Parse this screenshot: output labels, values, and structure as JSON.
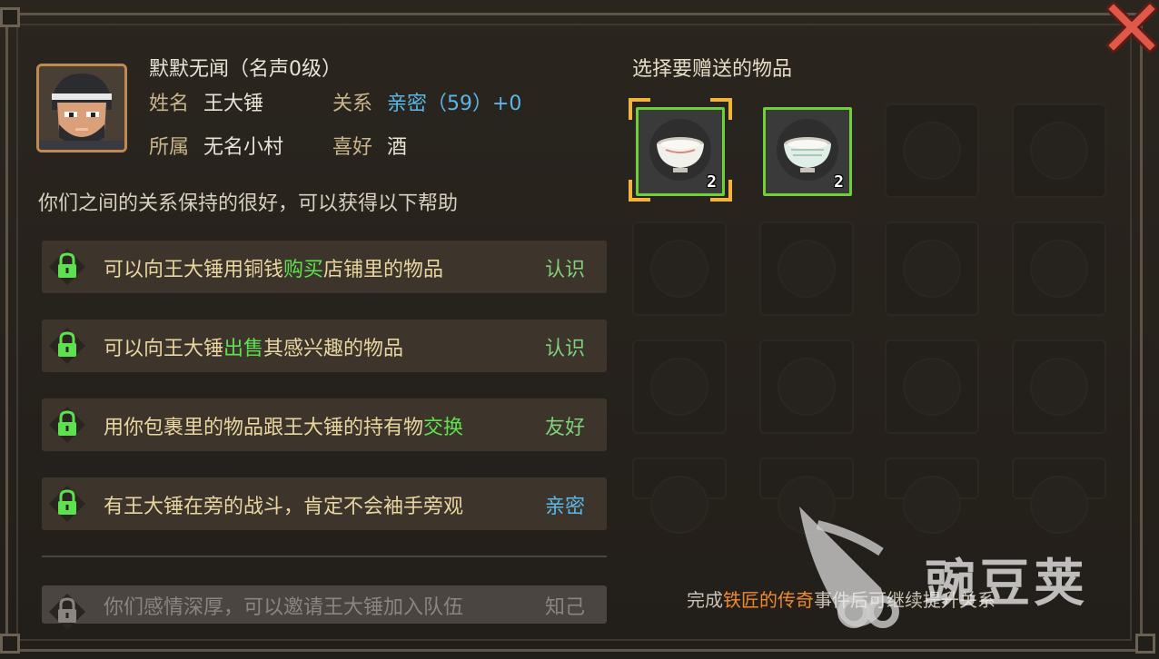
{
  "npc": {
    "title": "默默无闻（名声0级）",
    "name_label": "姓名",
    "name": "王大锤",
    "relation_label": "关系",
    "relation": "亲密（59）+0",
    "faction_label": "所属",
    "faction": "无名小村",
    "hobby_label": "喜好",
    "hobby": "酒"
  },
  "intro": "你们之间的关系保持的很好，可以获得以下帮助",
  "help_rows": [
    {
      "pre": "可以向王大锤用铜钱",
      "hl": "购买",
      "post": "店铺里的物品",
      "level": "认识",
      "level_color": "#7fd07a",
      "locked": false
    },
    {
      "pre": "可以向王大锤",
      "hl": "出售",
      "post": "其感兴趣的物品",
      "level": "认识",
      "level_color": "#7fd07a",
      "locked": false
    },
    {
      "pre": "用你包裹里的物品跟王大锤的持有物",
      "hl": "交换",
      "post": "",
      "level": "友好",
      "level_color": "#7fd07a",
      "locked": false
    },
    {
      "pre": "有王大锤在旁的战斗，肯定不会袖手旁观",
      "hl": "",
      "post": "",
      "level": "亲密",
      "level_color": "#5ab7e6",
      "locked": false
    },
    {
      "pre": "你们感情深厚，可以邀请王大锤加入队伍",
      "hl": "",
      "post": "",
      "level": "知己",
      "level_color": "#8a8580",
      "locked": true
    }
  ],
  "gift": {
    "title": "选择要赠送的物品",
    "items": [
      {
        "icon": "rice-bowl-icon",
        "count": "2",
        "selected": true
      },
      {
        "icon": "porcelain-bowl-icon",
        "count": "2",
        "selected": false
      }
    ]
  },
  "footer": {
    "pre": "完成",
    "hl": "铁匠的传奇",
    "post": "事件后可继续提升关系"
  },
  "watermark": "豌豆荚",
  "colors": {
    "accent_green": "#5ee14f",
    "slot_border": "#6fcf3a",
    "relation_blue": "#5ab7e6",
    "footer_orange": "#f08a2e"
  }
}
